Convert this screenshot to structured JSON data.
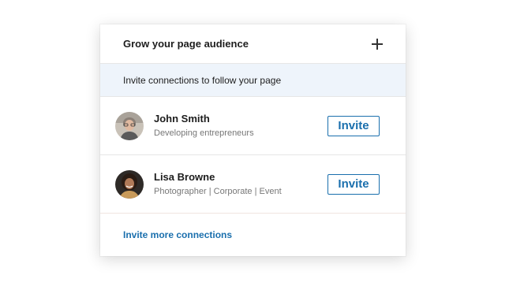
{
  "card": {
    "title": "Grow your page audience",
    "subtitle": "Invite connections to follow your page",
    "footer_link": "Invite more connections"
  },
  "connections": [
    {
      "name": "John Smith",
      "headline": "Developing entrepreneurs",
      "button_label": "Invite",
      "avatar": "john-smith-avatar"
    },
    {
      "name": "Lisa Browne",
      "headline": "Photographer | Corporate | Event",
      "button_label": "Invite",
      "avatar": "lisa-browne-avatar"
    }
  ],
  "colors": {
    "accent": "#1a6fad",
    "subheader_bg": "#eef4fb"
  }
}
